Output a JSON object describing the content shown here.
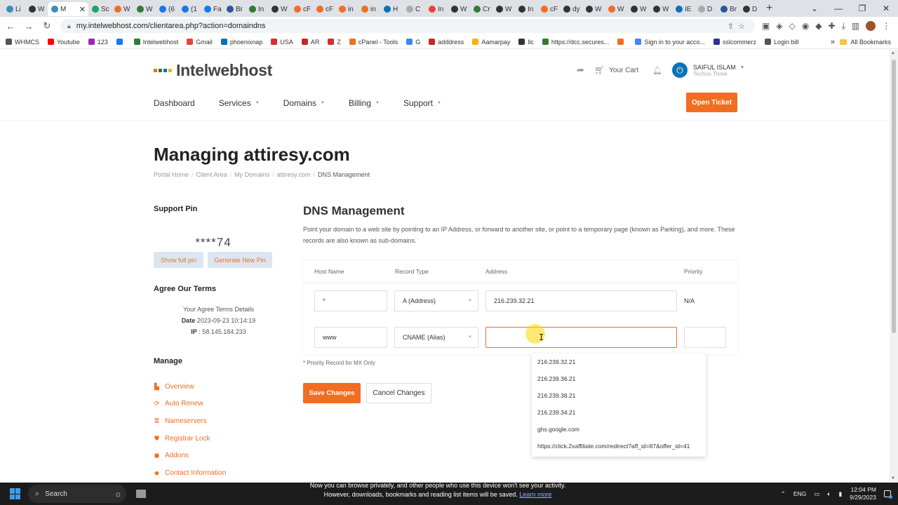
{
  "browser": {
    "active_tab": "M",
    "tabs": [
      "Li",
      "W",
      "Sc",
      "W",
      "W",
      "(6",
      "(1",
      "Fa",
      "Br",
      "In",
      "W",
      "cF",
      "cF",
      "in",
      "in",
      "H",
      "C",
      "In",
      "W",
      "Cr",
      "W",
      "In",
      "cF",
      "dy",
      "W",
      "W",
      "W",
      "W",
      "IE",
      "D",
      "Br",
      "D"
    ],
    "tab_colors": [
      "#3c8dbc",
      "#333333",
      "#1da462",
      "#f26d21",
      "#2e7d32",
      "#1877f2",
      "#1877f2",
      "#1877f2",
      "#2b5797",
      "#2e7d32",
      "#333333",
      "#f26d21",
      "#f26d21",
      "#f26d21",
      "#f26d21",
      "#0a72b8",
      "#aaaaaa",
      "#ea4335",
      "#333333",
      "#2e7d32",
      "#333333",
      "#333333",
      "#f26d21",
      "#333333",
      "#333333",
      "#f26d21",
      "#333333",
      "#333333",
      "#0a72b8",
      "#aaaaaa",
      "#2b5797",
      "#333333"
    ],
    "url": "my.intelwebhost.com/clientarea.php?action=domaindns",
    "bookmarks": [
      {
        "label": "WHMCS",
        "color": "#555555"
      },
      {
        "label": "Youtube",
        "color": "#ff0000"
      },
      {
        "label": "123",
        "color": "#9c27b0"
      },
      {
        "label": "",
        "color": "#1877f2"
      },
      {
        "label": "Intelwebhost",
        "color": "#2e7d32"
      },
      {
        "label": "Gmail",
        "color": "#ea4335"
      },
      {
        "label": "phoenixnap",
        "color": "#0a72b8"
      },
      {
        "label": "USA",
        "color": "#d32f2f"
      },
      {
        "label": "AR",
        "color": "#c62828"
      },
      {
        "label": "Z",
        "color": "#d32f2f"
      },
      {
        "label": "cPanel - Tools",
        "color": "#f26d21"
      },
      {
        "label": "G",
        "color": "#4285f4"
      },
      {
        "label": "adddress",
        "color": "#c62828"
      },
      {
        "label": "Aamarpay",
        "color": "#f4b400"
      },
      {
        "label": "llc",
        "color": "#333333"
      },
      {
        "label": "https://dcc.secures...",
        "color": "#2e7d32"
      },
      {
        "label": "",
        "color": "#f26d21"
      },
      {
        "label": "Sign in to your acco...",
        "color": "#4285f4"
      },
      {
        "label": "sslcommerz",
        "color": "#283593"
      },
      {
        "label": "Login bill",
        "color": "#555555"
      }
    ],
    "all_bookmarks": "All Bookmarks"
  },
  "header": {
    "logo_text": "Intelwebhost",
    "logo_colors": [
      "#f26d21",
      "#2e7d32",
      "#0a72b8",
      "#f4b400"
    ],
    "cart_label": "Your Cart",
    "user_name": "SAIFUL ISLAM",
    "user_company": "Techno Three",
    "nav": [
      {
        "label": "Dashboard",
        "has_caret": false
      },
      {
        "label": "Services",
        "has_caret": true
      },
      {
        "label": "Domains",
        "has_caret": true
      },
      {
        "label": "Billing",
        "has_caret": true
      },
      {
        "label": "Support",
        "has_caret": true
      }
    ],
    "open_ticket": "Open Ticket"
  },
  "page": {
    "title": "Managing attiresy.com",
    "breadcrumb": [
      "Portal Home",
      "Client Area",
      "My Domains",
      "attiresy.com",
      "DNS Management"
    ]
  },
  "sidebar": {
    "support_pin_title": "Support Pin",
    "pin_value": "****74",
    "show_pin": "Show full pin",
    "generate_pin": "Generate New Pin",
    "terms_title": "Agree Our Terms",
    "terms_details": "Your Agree Terms Details",
    "date_label": "Date",
    "date_value": "2023-09-23 10:14:19",
    "ip_label": "IP",
    "ip_value": " : 58.145.184.233",
    "manage_title": "Manage",
    "manage_items": [
      {
        "label": "Overview",
        "icon": "overview-icon"
      },
      {
        "label": "Auto Renew",
        "icon": "refresh-icon"
      },
      {
        "label": "Nameservers",
        "icon": "server-icon"
      },
      {
        "label": "Registrar Lock",
        "icon": "lock-icon"
      },
      {
        "label": "Addons",
        "icon": "cube-icon"
      },
      {
        "label": "Contact Information",
        "icon": "user-icon"
      }
    ]
  },
  "dns": {
    "title": "DNS Management",
    "description": "Point your domain to a web site by pointing to an IP Address, or forward to another site, or point to a temporary page (known as Parking), and more. These records are also known as sub-domains.",
    "headers": {
      "host": "Host Name",
      "type": "Record Type",
      "address": "Address",
      "priority": "Priority"
    },
    "rows": [
      {
        "host": "*",
        "type": "A (Address)",
        "address": "216.239.32.21",
        "priority": "N/A"
      },
      {
        "host": "www",
        "type": "CNAME (Alias)",
        "address": "",
        "priority": ""
      }
    ],
    "mx_note": "* Priority Record for MX Only",
    "save": "Save Changes",
    "cancel": "Cancel Changes",
    "suggestions": [
      "216.239.32.21",
      "216.239.36.21",
      "216.239.38.21",
      "216.239.34.21",
      "ghs.google.com",
      "https://click.2xaffiliate.com/redirect?aff_id=87&offer_id=41"
    ]
  },
  "notice": {
    "line1": "Now you can browse privately, and other people who use this device won't see your activity.",
    "line2": "However, downloads, bookmarks and reading list items will be saved.",
    "link": "Learn more"
  },
  "taskbar": {
    "search": "Search",
    "lang": "ENG",
    "time": "12:04 PM",
    "date": "9/29/2023"
  },
  "colors": {
    "accent": "#f26d21",
    "brand_blue": "#0a72b8"
  }
}
